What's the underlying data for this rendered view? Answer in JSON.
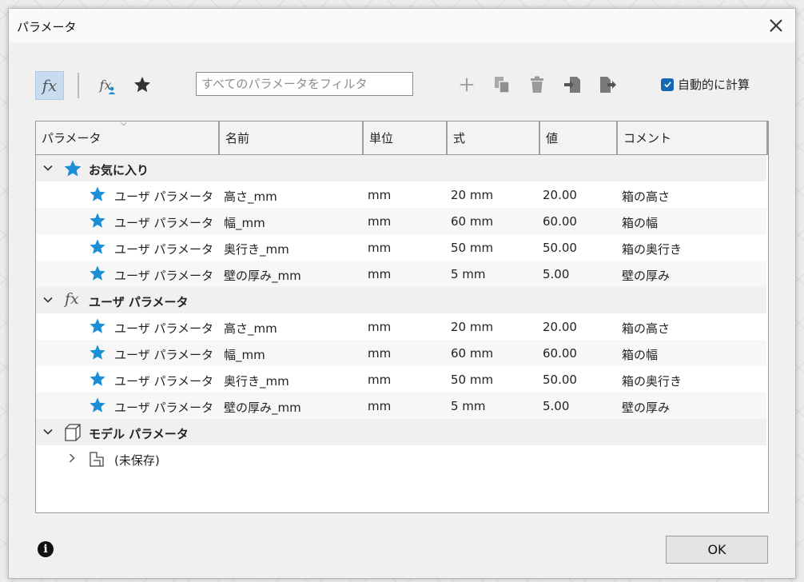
{
  "window": {
    "title": "パラメータ"
  },
  "toolbar": {
    "fx_symbol": "fx",
    "filter_placeholder": "すべてのパラメータをフィルタ",
    "auto_calc_label": "自動的に計算",
    "auto_calc_checked": true
  },
  "columns": [
    "パラメータ",
    "名前",
    "単位",
    "式",
    "値",
    "コメント"
  ],
  "groups": [
    {
      "label": "お気に入り",
      "icon": "star-icon",
      "expanded": true,
      "rows": [
        {
          "param": "ユーザ パラメータ",
          "name": "高さ_mm",
          "unit": "mm",
          "expr": "20 mm",
          "value": "20.00",
          "comment": "箱の高さ"
        },
        {
          "param": "ユーザ パラメータ",
          "name": "幅_mm",
          "unit": "mm",
          "expr": "60 mm",
          "value": "60.00",
          "comment": "箱の幅"
        },
        {
          "param": "ユーザ パラメータ",
          "name": "奥行き_mm",
          "unit": "mm",
          "expr": "50 mm",
          "value": "50.00",
          "comment": "箱の奥行き"
        },
        {
          "param": "ユーザ パラメータ",
          "name": "壁の厚み_mm",
          "unit": "mm",
          "expr": "5 mm",
          "value": "5.00",
          "comment": "壁の厚み"
        }
      ]
    },
    {
      "label": "ユーザ パラメータ",
      "icon": "fx-icon",
      "expanded": true,
      "rows": [
        {
          "param": "ユーザ パラメータ",
          "name": "高さ_mm",
          "unit": "mm",
          "expr": "20 mm",
          "value": "20.00",
          "comment": "箱の高さ"
        },
        {
          "param": "ユーザ パラメータ",
          "name": "幅_mm",
          "unit": "mm",
          "expr": "60 mm",
          "value": "60.00",
          "comment": "箱の幅"
        },
        {
          "param": "ユーザ パラメータ",
          "name": "奥行き_mm",
          "unit": "mm",
          "expr": "50 mm",
          "value": "50.00",
          "comment": "箱の奥行き"
        },
        {
          "param": "ユーザ パラメータ",
          "name": "壁の厚み_mm",
          "unit": "mm",
          "expr": "5 mm",
          "value": "5.00",
          "comment": "壁の厚み"
        }
      ]
    },
    {
      "label": "モデル パラメータ",
      "icon": "model-cube-icon",
      "expanded": true,
      "children": [
        {
          "label": "(未保存)",
          "icon": "component-icon",
          "expanded": false
        }
      ]
    }
  ],
  "footer": {
    "ok_label": "OK"
  },
  "colors": {
    "accent": "#1467b3",
    "star": "#1a8fd6"
  }
}
